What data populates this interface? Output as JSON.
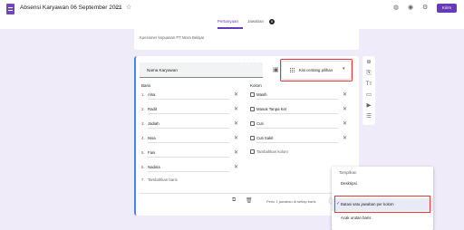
{
  "header": {
    "form_title": "Absensi Karyawan 06 September 2021",
    "submit_label": "Kirim",
    "tabs": [
      {
        "label": "Pertanyaan",
        "active": true
      },
      {
        "label": "Jawaban",
        "active": false
      }
    ],
    "responses_badge": "8"
  },
  "description_card": {
    "text": "Kuesioner kepuasan PT Mora Belajar"
  },
  "question": {
    "title_value": "Nama Karyawan",
    "type_label": "Kisi centang pilihan",
    "rows_heading": "Baris",
    "columns_heading": "Kolom",
    "rows": [
      {
        "num": "1.",
        "label": "Alsa"
      },
      {
        "num": "2.",
        "label": "Radit"
      },
      {
        "num": "3.",
        "label": "Jadiah"
      },
      {
        "num": "4.",
        "label": "Nisa"
      },
      {
        "num": "5.",
        "label": "Fani"
      },
      {
        "num": "6.",
        "label": "Nadina"
      }
    ],
    "add_row": "Tambahkan baris",
    "columns": [
      {
        "label": "Masih"
      },
      {
        "label": "Masuk Tanpa Ket"
      },
      {
        "label": "Cuti"
      },
      {
        "label": "Cuti Sakit"
      }
    ],
    "add_column": "Tambahkan kolom",
    "require_toggle_label": "Perlu 1 jawaban di setiap baris"
  },
  "menu": {
    "heading": "Tampilkan",
    "items": [
      {
        "label": "Deskripsi",
        "checked": false
      },
      {
        "label": "Batasi satu jawaban per kolom",
        "checked": true
      },
      {
        "label": "Acak urutan baris",
        "checked": false
      }
    ]
  },
  "colors": {
    "accent": "#673ab7",
    "background": "#f0ebf8",
    "highlight": "#e53935",
    "active_border": "#4285f4"
  }
}
